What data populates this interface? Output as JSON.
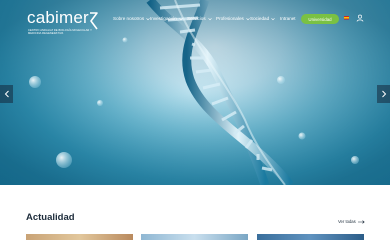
{
  "header": {
    "logo_word": "cabimer",
    "logo_subtitle": "CENTRO ANDALUZ DE BIOLOGÍA MOLECULAR Y MEDICINA REGENERATIVA",
    "nav": [
      {
        "label": "Sobre nosotros"
      },
      {
        "label": "Investigación"
      },
      {
        "label": "Servicios"
      },
      {
        "label": "Profesionales"
      },
      {
        "label": "Sociedad"
      },
      {
        "label": "Intranet"
      }
    ],
    "cta_label": "Universidad",
    "accent": "#7ac143"
  },
  "main": {
    "section_title": "Actualidad",
    "see_all_label": "Ver todas"
  }
}
